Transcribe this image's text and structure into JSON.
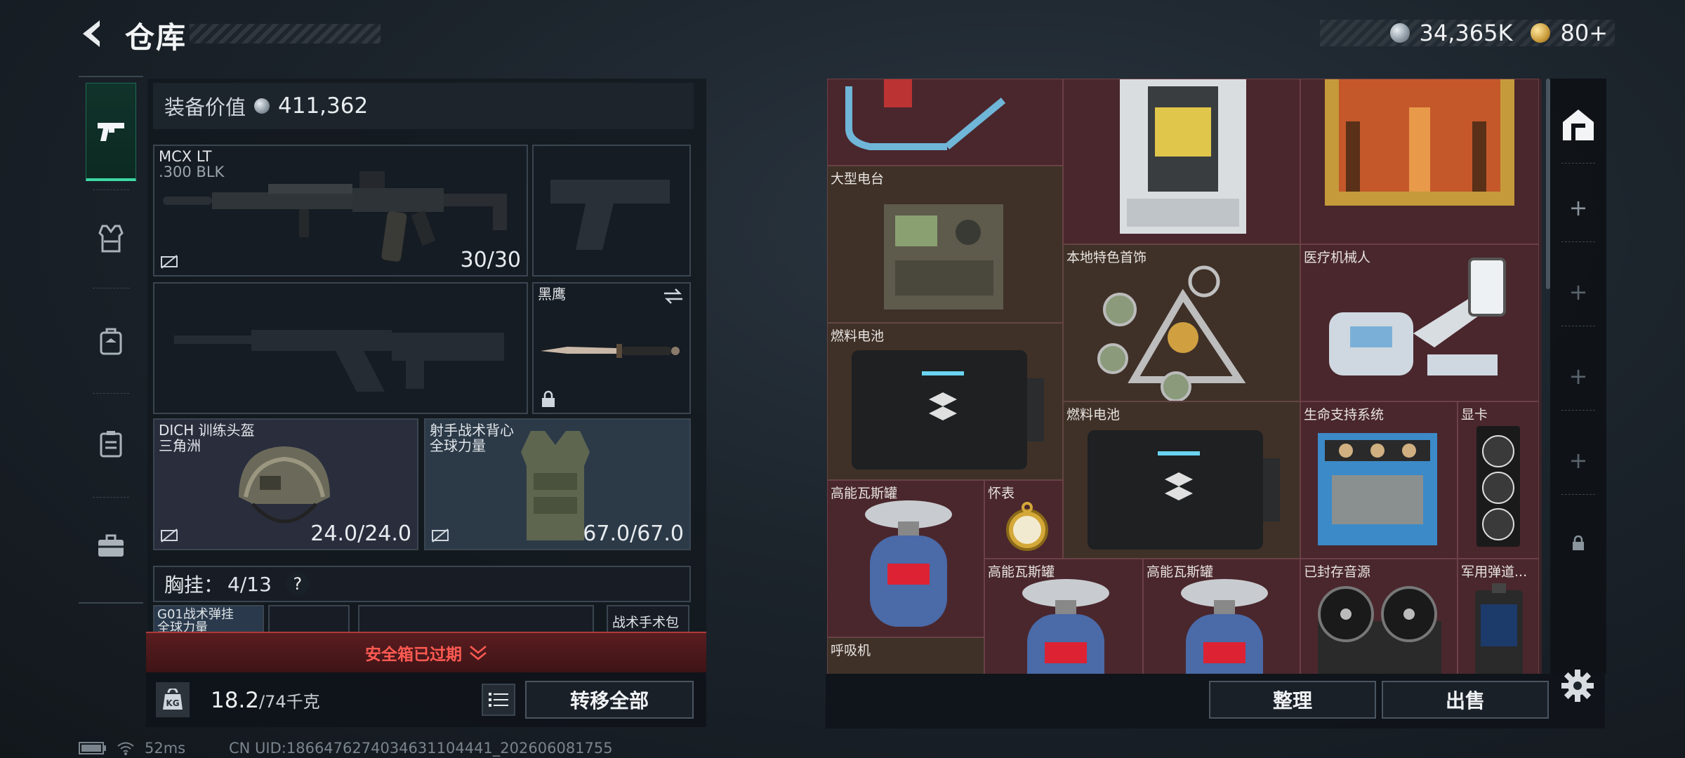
{
  "header": {
    "title": "仓库"
  },
  "currency": {
    "silver": "34,365K",
    "gold": "80+"
  },
  "equipment": {
    "value_label": "装备价值",
    "value": "411,362",
    "primary": {
      "name": "MCX LT",
      "caliber": ".300 BLK",
      "ammo": "30/30"
    },
    "melee": {
      "name": "黑鹰"
    },
    "helmet": {
      "name": "DICH 训练头盔",
      "faction": "三角洲",
      "durability": "24.0/24.0"
    },
    "vest": {
      "name": "射手战术背心",
      "faction": "全球力量",
      "durability": "67.0/67.0"
    },
    "chest_label": "胸挂：",
    "chest_count": "4/13",
    "chest_help": "?",
    "sub_slot_1": "G01战术弹挂",
    "sub_slot_1_sub": "全球力量",
    "sub_slot_right": "战术手术包"
  },
  "safe_box": {
    "label": "安全箱已过期"
  },
  "weight": {
    "current": "18.2",
    "max": "/74千克"
  },
  "buttons": {
    "transfer_all": "转移全部",
    "organize": "整理",
    "sell": "出售"
  },
  "grid_items": [
    {
      "name": "大型电台"
    },
    {
      "name": "本地特色首饰"
    },
    {
      "name": "医疗机械人"
    },
    {
      "name": "燃料电池"
    },
    {
      "name": "燃料电池"
    },
    {
      "name": "生命支持系统"
    },
    {
      "name": "显卡"
    },
    {
      "name": "高能瓦斯罐"
    },
    {
      "name": "怀表"
    },
    {
      "name": "高能瓦斯罐"
    },
    {
      "name": "高能瓦斯罐"
    },
    {
      "name": "已封存音源"
    },
    {
      "name": "军用弹道..."
    },
    {
      "name": "呼吸机"
    }
  ],
  "status": {
    "ping": "52ms",
    "uid": "CN UID:1866476274034631104441_202606081755"
  },
  "icons": [
    "back-arrow-icon",
    "pistol-icon",
    "vest-icon",
    "backpack-icon",
    "case-icon",
    "briefcase-icon",
    "swap-icon",
    "lock-icon",
    "no-drop-icon",
    "weight-icon",
    "list-icon",
    "house-icon",
    "plus-icon",
    "gear-icon",
    "battery-icon",
    "wifi-icon"
  ]
}
